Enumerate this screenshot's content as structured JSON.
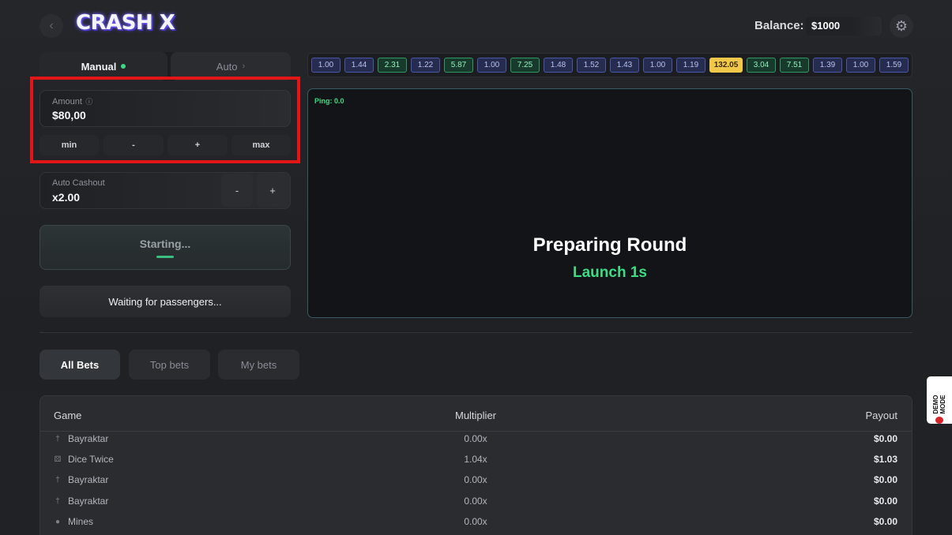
{
  "header": {
    "logo": "CRASH X",
    "balance_label": "Balance:",
    "balance_value": "$1000"
  },
  "bet_panel": {
    "tabs": [
      {
        "label": "Manual",
        "active": true
      },
      {
        "label": "Auto",
        "active": false
      }
    ],
    "amount": {
      "label": "Amount",
      "value": "$80,00"
    },
    "amount_buttons": [
      "min",
      "-",
      "+",
      "max"
    ],
    "auto_cashout": {
      "label": "Auto Cashout",
      "value": "x2.00",
      "minus": "-",
      "plus": "+"
    },
    "start_button": "Starting...",
    "status_text": "Waiting for passengers..."
  },
  "history": [
    {
      "value": "1.00",
      "color": "blue"
    },
    {
      "value": "1.44",
      "color": "blue"
    },
    {
      "value": "2.31",
      "color": "green"
    },
    {
      "value": "1.22",
      "color": "blue"
    },
    {
      "value": "5.87",
      "color": "green"
    },
    {
      "value": "1.00",
      "color": "blue"
    },
    {
      "value": "7.25",
      "color": "green"
    },
    {
      "value": "1.48",
      "color": "blue"
    },
    {
      "value": "1.52",
      "color": "blue"
    },
    {
      "value": "1.43",
      "color": "blue"
    },
    {
      "value": "1.00",
      "color": "blue"
    },
    {
      "value": "1.19",
      "color": "blue"
    },
    {
      "value": "132.05",
      "color": "gold"
    },
    {
      "value": "3.04",
      "color": "green"
    },
    {
      "value": "7.51",
      "color": "green"
    },
    {
      "value": "1.39",
      "color": "blue"
    },
    {
      "value": "1.00",
      "color": "blue"
    },
    {
      "value": "1.59",
      "color": "blue"
    }
  ],
  "game": {
    "ping": "Ping: 0.0",
    "status_title": "Preparing Round",
    "status_sub": "Launch 1s"
  },
  "bets": {
    "tabs": [
      "All Bets",
      "Top bets",
      "My bets"
    ],
    "columns": {
      "game": "Game",
      "multiplier": "Multiplier",
      "payout": "Payout"
    },
    "rows": [
      {
        "game": "Bayraktar",
        "icon": "rocket-icon",
        "multiplier": "0.00x",
        "payout": "$0.00"
      },
      {
        "game": "Dice Twice",
        "icon": "dice-icon",
        "multiplier": "1.04x",
        "payout": "$1.03"
      },
      {
        "game": "Bayraktar",
        "icon": "rocket-icon",
        "multiplier": "0.00x",
        "payout": "$0.00"
      },
      {
        "game": "Bayraktar",
        "icon": "rocket-icon",
        "multiplier": "0.00x",
        "payout": "$0.00"
      },
      {
        "game": "Mines",
        "icon": "bomb-icon",
        "multiplier": "0.00x",
        "payout": "$0.00"
      }
    ]
  },
  "demo_badge": "DEMO MODE",
  "colors": {
    "accent_green": "#3ddc84",
    "gold": "#f1c84a",
    "highlight_red": "#e11616"
  }
}
